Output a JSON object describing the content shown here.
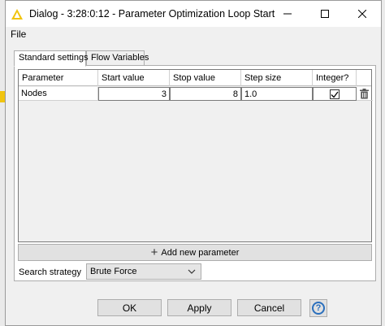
{
  "window": {
    "title": "Dialog - 3:28:0:12 - Parameter Optimization Loop Start",
    "icon": "knime-warning-triangle-icon",
    "controls": [
      "minimize-icon",
      "maximize-icon",
      "close-icon"
    ]
  },
  "menu": {
    "items": [
      "File"
    ]
  },
  "tabs": [
    {
      "label": "Standard settings",
      "active": true
    },
    {
      "label": "Flow Variables",
      "active": false
    }
  ],
  "table": {
    "columns": [
      "Parameter",
      "Start value",
      "Stop value",
      "Step size",
      "Integer?",
      ""
    ],
    "rows": [
      {
        "parameter": "Nodes",
        "start": "3",
        "stop": "8",
        "step": "1.0",
        "integer": true,
        "delete_icon": "trash-icon"
      }
    ]
  },
  "add_parameter": {
    "label": "Add new parameter",
    "icon": "plus-icon"
  },
  "strategy": {
    "label": "Search strategy",
    "value": "Brute Force"
  },
  "buttons": {
    "ok": "OK",
    "apply": "Apply",
    "cancel": "Cancel",
    "help_icon": "help-icon",
    "help_glyph": "?"
  },
  "colors": {
    "accent": "#f1c40f",
    "help": "#2a6fbd"
  }
}
